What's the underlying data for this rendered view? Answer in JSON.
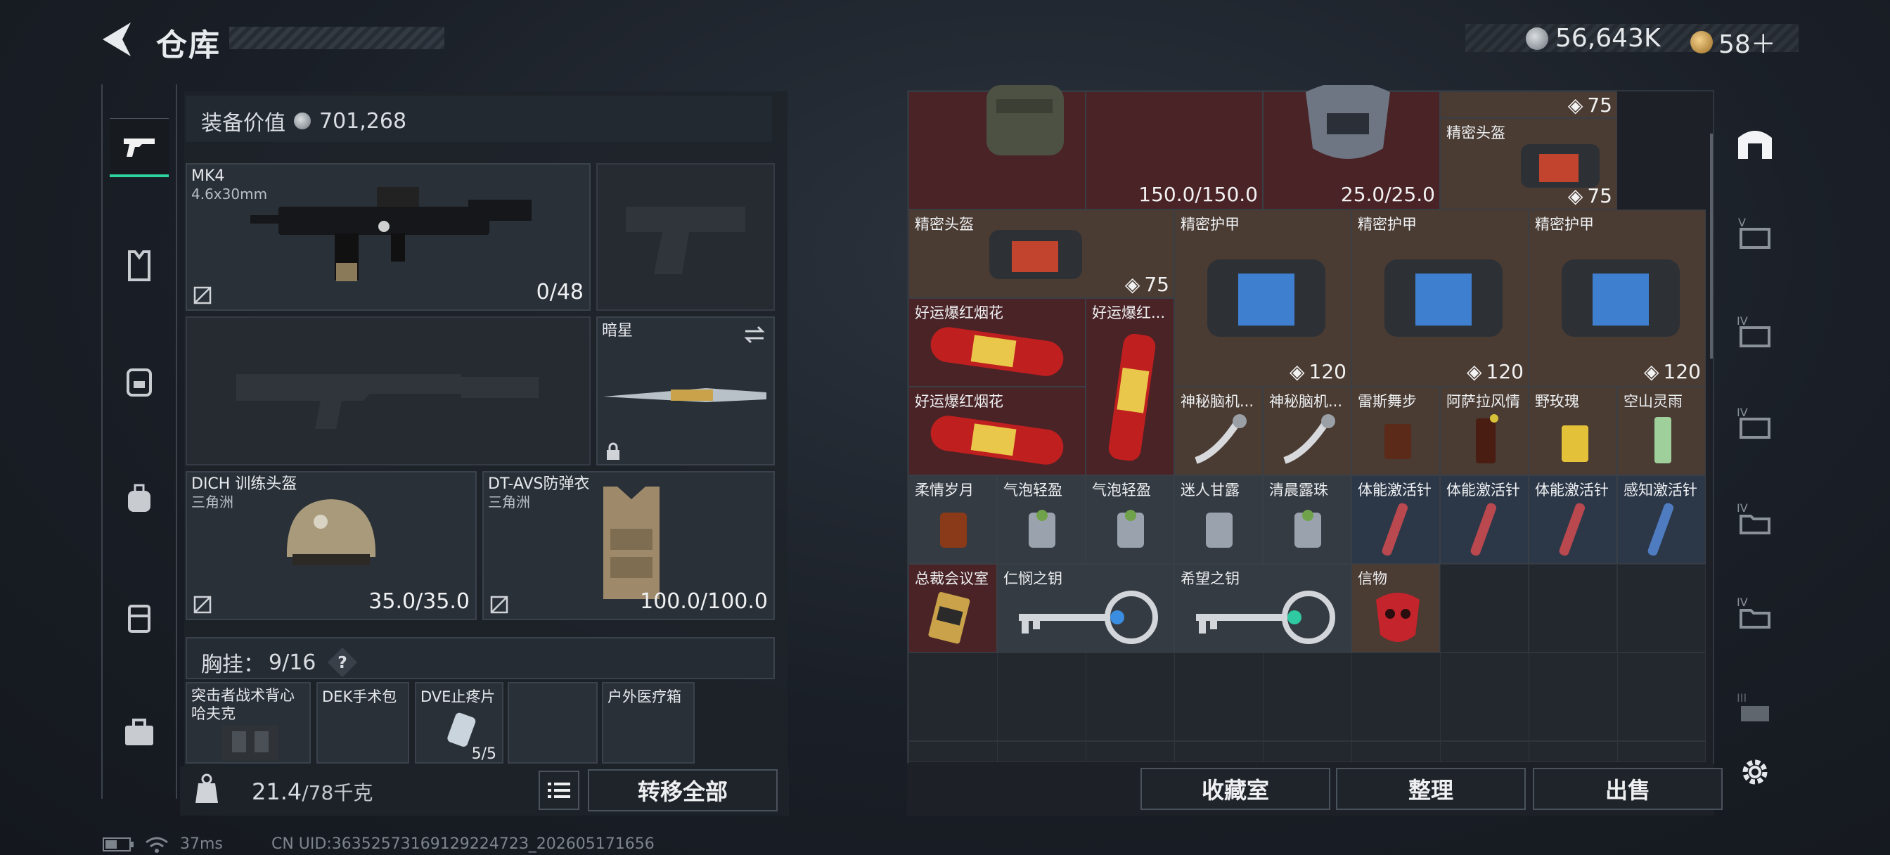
{
  "header": {
    "title": "仓库",
    "coins": "56,643K",
    "tokens": "58＋"
  },
  "sidebar": {
    "items": [
      "weapon",
      "armor",
      "backpack",
      "bag",
      "container",
      "toolbox"
    ]
  },
  "loadout": {
    "value_label": "装备价值",
    "value": "701,268",
    "primary": {
      "name": "MK4",
      "caliber": "4.6x30mm",
      "ammo": "0/48"
    },
    "melee": {
      "name": "暗星"
    },
    "helmet": {
      "name": "DICH 训练头盔",
      "origin": "三角洲",
      "durability": "35.0/35.0"
    },
    "armor": {
      "name": "DT-AVS防弹衣",
      "origin": "三角洲",
      "durability": "100.0/100.0"
    },
    "rig": {
      "label": "胸挂：",
      "count": "9/16",
      "help": "?"
    },
    "pockets": [
      {
        "name": "突击者战术背心",
        "sub": "哈夫克"
      },
      {
        "name": "DEK手术包",
        "sub": ""
      },
      {
        "name": "DVE止疼片",
        "sub": "5/5"
      },
      {
        "name": "",
        "sub": ""
      },
      {
        "name": "户外医疗箱",
        "sub": ""
      }
    ],
    "weight": "21.4",
    "weight_max": "/78千克",
    "transfer_label": "转移全部"
  },
  "storage": {
    "row0": [
      {
        "name": "",
        "durability": "150.0/150.0"
      },
      {
        "name": "",
        "durability": "25.0/25.0"
      },
      {
        "name": "",
        "shield": "75"
      },
      {
        "name": "精密头盔",
        "shield": "75"
      }
    ],
    "row1": [
      {
        "name": "精密头盔",
        "shield": "75"
      },
      {
        "name": "精密护甲",
        "shield": "120"
      },
      {
        "name": "精密护甲",
        "shield": "120"
      },
      {
        "name": "精密护甲",
        "shield": "120"
      }
    ],
    "row2": [
      {
        "name": "好运爆红烟花"
      },
      {
        "name": "好运爆红..."
      }
    ],
    "row3": [
      {
        "name": "好运爆红烟花"
      },
      {
        "name": "神秘脑机..."
      },
      {
        "name": "神秘脑机..."
      },
      {
        "name": "雷斯舞步"
      },
      {
        "name": "阿萨拉风情"
      },
      {
        "name": "野玫瑰"
      },
      {
        "name": "空山灵雨"
      }
    ],
    "row4": [
      {
        "name": "柔情岁月"
      },
      {
        "name": "气泡轻盈"
      },
      {
        "name": "气泡轻盈"
      },
      {
        "name": "迷人甘露"
      },
      {
        "name": "清晨露珠"
      },
      {
        "name": "体能激活针"
      },
      {
        "name": "体能激活针"
      },
      {
        "name": "体能激活针"
      },
      {
        "name": "感知激活针"
      }
    ],
    "row5": [
      {
        "name": "总裁会议室"
      },
      {
        "name": "仁悯之钥"
      },
      {
        "name": "希望之钥"
      },
      {
        "name": "信物"
      }
    ],
    "buttons": {
      "collection": "收藏室",
      "sort": "整理",
      "sell": "出售"
    }
  },
  "status": {
    "ping": "37ms",
    "uid": "CN UID:3635257316912922472З_202605171656"
  },
  "colors": {
    "accent": "#2fd39d",
    "red_rarity": "#4a2327",
    "gold_rarity": "#4a3b33",
    "blue_rarity": "#2c3848"
  }
}
